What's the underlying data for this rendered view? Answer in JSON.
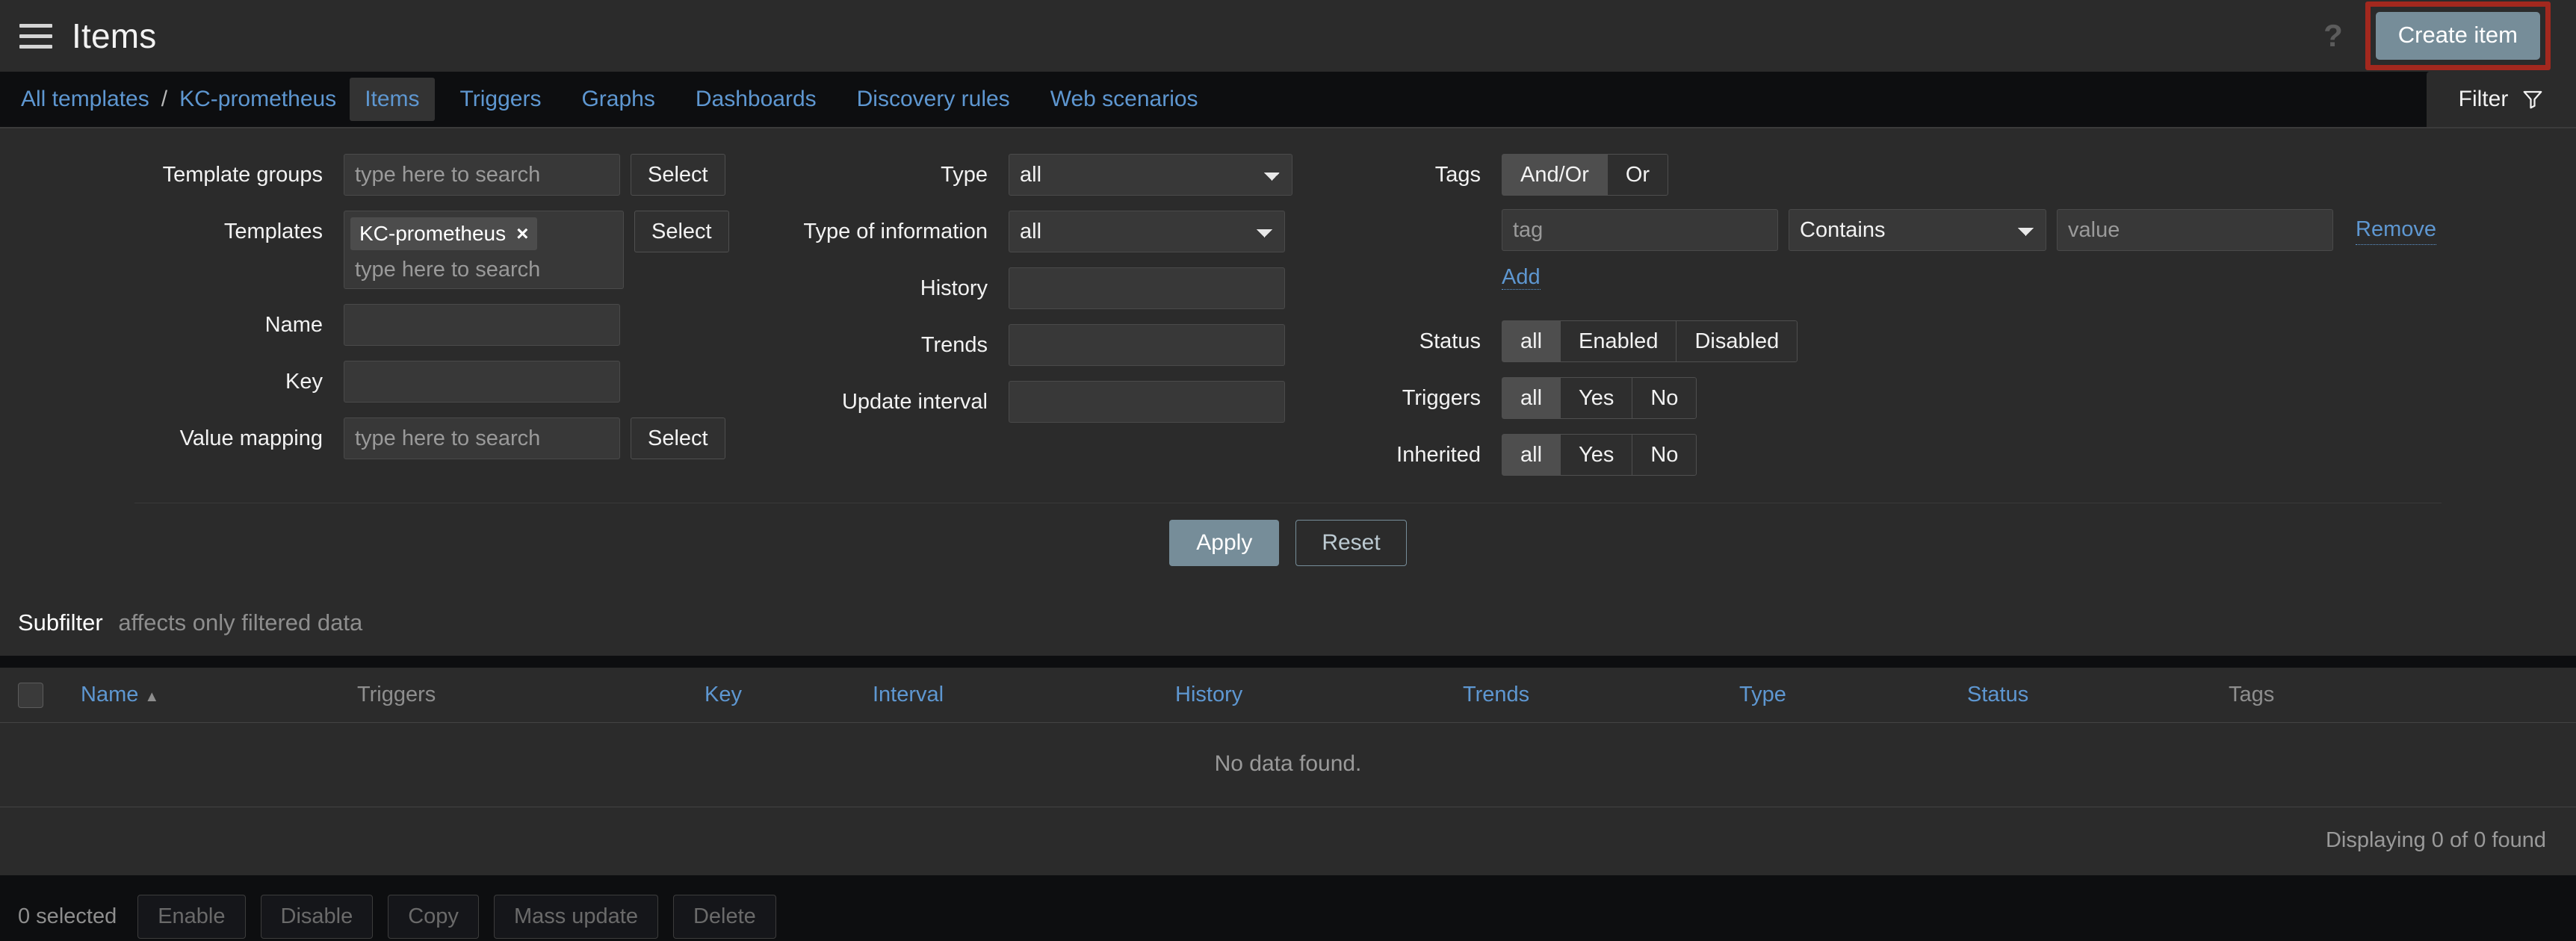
{
  "header": {
    "menu_icon": "hamburger-icon",
    "title": "Items",
    "help_icon": "?",
    "create_button": "Create item"
  },
  "nav": {
    "breadcrumb": [
      {
        "label": "All templates"
      },
      {
        "label": "KC-prometheus"
      }
    ],
    "separator": "/",
    "tabs": [
      {
        "label": "Items",
        "active": true
      },
      {
        "label": "Triggers",
        "active": false
      },
      {
        "label": "Graphs",
        "active": false
      },
      {
        "label": "Dashboards",
        "active": false
      },
      {
        "label": "Discovery rules",
        "active": false
      },
      {
        "label": "Web scenarios",
        "active": false
      }
    ],
    "filter_tab": {
      "label": "Filter",
      "icon": "funnel-icon"
    }
  },
  "filter": {
    "template_groups": {
      "label": "Template groups",
      "placeholder": "type here to search",
      "value": "",
      "select_button": "Select"
    },
    "templates": {
      "label": "Templates",
      "chips": [
        {
          "label": "KC-prometheus",
          "remove": "×"
        }
      ],
      "placeholder": "type here to search",
      "value": "",
      "select_button": "Select"
    },
    "name": {
      "label": "Name",
      "value": "",
      "placeholder": ""
    },
    "key": {
      "label": "Key",
      "value": "",
      "placeholder": ""
    },
    "value_mapping": {
      "label": "Value mapping",
      "placeholder": "type here to search",
      "value": "",
      "select_button": "Select"
    },
    "type": {
      "label": "Type",
      "selected": "all",
      "options": [
        "all"
      ]
    },
    "type_of_information": {
      "label": "Type of information",
      "selected": "all",
      "options": [
        "all"
      ]
    },
    "history": {
      "label": "History",
      "value": "",
      "placeholder": ""
    },
    "trends": {
      "label": "Trends",
      "value": "",
      "placeholder": ""
    },
    "update_interval": {
      "label": "Update interval",
      "value": "",
      "placeholder": ""
    },
    "tags": {
      "label": "Tags",
      "operator_options": [
        {
          "label": "And/Or",
          "selected": true
        },
        {
          "label": "Or",
          "selected": false
        }
      ],
      "tag_placeholder": "tag",
      "tag_value": "",
      "condition": {
        "selected": "Contains",
        "options": [
          "Contains"
        ]
      },
      "value_placeholder": "value",
      "value_value": "",
      "remove_link": "Remove",
      "add_link": "Add"
    },
    "status": {
      "label": "Status",
      "options": [
        {
          "label": "all",
          "selected": true
        },
        {
          "label": "Enabled",
          "selected": false
        },
        {
          "label": "Disabled",
          "selected": false
        }
      ]
    },
    "triggers": {
      "label": "Triggers",
      "options": [
        {
          "label": "all",
          "selected": true
        },
        {
          "label": "Yes",
          "selected": false
        },
        {
          "label": "No",
          "selected": false
        }
      ]
    },
    "inherited": {
      "label": "Inherited",
      "options": [
        {
          "label": "all",
          "selected": true
        },
        {
          "label": "Yes",
          "selected": false
        },
        {
          "label": "No",
          "selected": false
        }
      ]
    },
    "apply_button": "Apply",
    "reset_button": "Reset"
  },
  "subfilter": {
    "title": "Subfilter",
    "note": "affects only filtered data"
  },
  "table": {
    "columns": [
      {
        "label": "Name",
        "sortable": true,
        "sort": "asc",
        "arrow": "▲"
      },
      {
        "label": "Triggers",
        "sortable": false
      },
      {
        "label": "Key",
        "sortable": true
      },
      {
        "label": "Interval",
        "sortable": true
      },
      {
        "label": "History",
        "sortable": true
      },
      {
        "label": "Trends",
        "sortable": true
      },
      {
        "label": "Type",
        "sortable": true
      },
      {
        "label": "Status",
        "sortable": true
      },
      {
        "label": "Tags",
        "sortable": false
      }
    ],
    "rows": [],
    "empty_message": "No data found.",
    "displaying": "Displaying 0 of 0 found"
  },
  "actionbar": {
    "selected_count": "0 selected",
    "buttons": [
      {
        "label": "Enable",
        "disabled": true
      },
      {
        "label": "Disable",
        "disabled": true
      },
      {
        "label": "Copy",
        "disabled": true
      },
      {
        "label": "Mass update",
        "disabled": true
      },
      {
        "label": "Delete",
        "disabled": true
      }
    ]
  },
  "colors": {
    "page_background": "#0d0e10",
    "panel_background": "#2b2b2b",
    "accent_link": "#5e97d1",
    "primary_button": "#768d99",
    "highlight_border": "#a3281e",
    "muted_text": "#8e8e8e"
  }
}
